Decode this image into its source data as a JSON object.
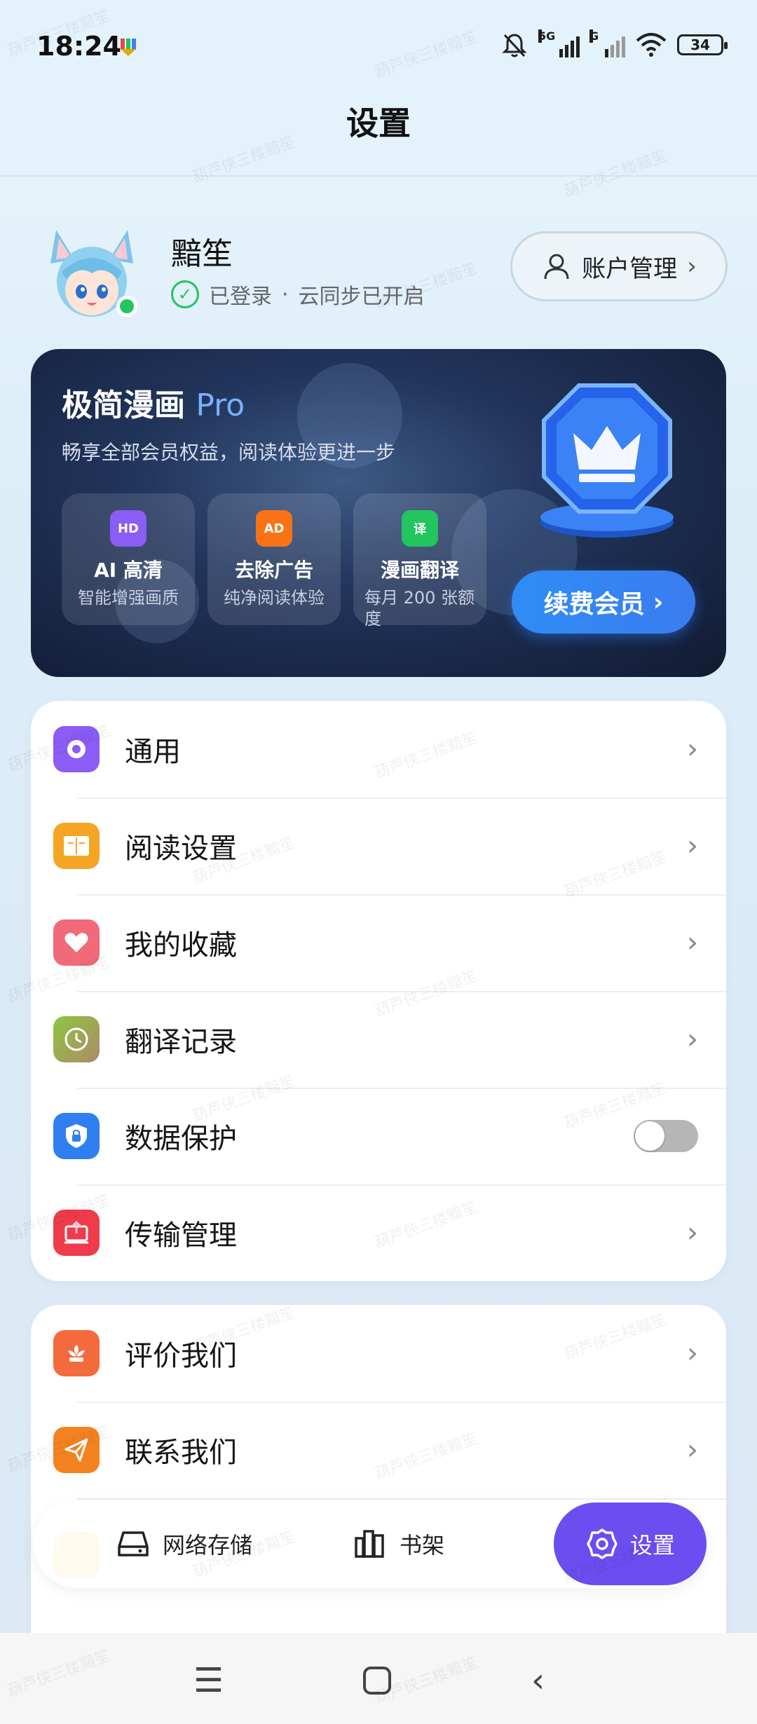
{
  "status_bar": {
    "time": "18:24",
    "network_5g": "5G",
    "network_g": "G",
    "battery": "34"
  },
  "header": {
    "title": "设置"
  },
  "profile": {
    "username": "黯笙",
    "login_status": "已登录",
    "separator": "·",
    "sync_status": "云同步已开启",
    "account_button_label": "账户管理"
  },
  "pro_card": {
    "title_main": "极简漫画",
    "title_pro": "Pro",
    "subtitle": "畅享全部会员权益，阅读体验更进一步",
    "features": [
      {
        "icon_text": "HD",
        "name": "AI 高清",
        "desc": "智能增强画质",
        "color": "#8b5cf6"
      },
      {
        "icon_text": "AD",
        "name": "去除广告",
        "desc": "纯净阅读体验",
        "color": "#f97316"
      },
      {
        "icon_text": "译",
        "name": "漫画翻译",
        "desc": "每月 200 张额度",
        "color": "#22c55e"
      }
    ],
    "renew_label": "续费会员"
  },
  "menu_group_1": [
    {
      "label": "通用",
      "icon": "gear-icon",
      "color": "#8b5cf6",
      "type": "link"
    },
    {
      "label": "阅读设置",
      "icon": "book-icon",
      "color": "#f5a524",
      "type": "link"
    },
    {
      "label": "我的收藏",
      "icon": "heart-icon",
      "color": "#f06a7a",
      "type": "link"
    },
    {
      "label": "翻译记录",
      "icon": "clock-icon",
      "color": "#8cc63f",
      "type": "link"
    },
    {
      "label": "数据保护",
      "icon": "shield-lock-icon",
      "color": "#2f7ff0",
      "type": "toggle",
      "enabled": false
    },
    {
      "label": "传输管理",
      "icon": "transfer-icon",
      "color": "#ef3b4b",
      "type": "link"
    }
  ],
  "menu_group_2": [
    {
      "label": "评价我们",
      "icon": "flower-icon",
      "color": "#f56a3c",
      "type": "link"
    },
    {
      "label": "联系我们",
      "icon": "paper-plane-icon",
      "color": "#f58220",
      "type": "link"
    }
  ],
  "bottom_nav": {
    "items": [
      {
        "label": "网络存储",
        "icon": "drive-icon"
      },
      {
        "label": "书架",
        "icon": "bookshelf-icon"
      }
    ],
    "active": {
      "label": "设置",
      "icon": "gear-icon"
    }
  },
  "watermark_text": "葫芦侠三楼黯笙"
}
